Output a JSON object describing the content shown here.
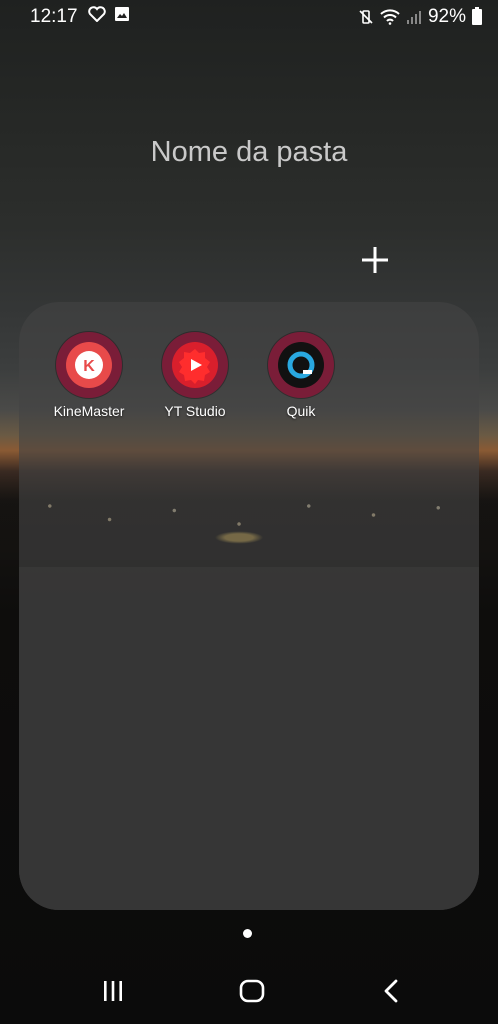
{
  "status_bar": {
    "time": "12:17",
    "battery_percent": "92%",
    "left_icons": [
      "heart-icon",
      "gallery-icon"
    ],
    "right_icons": [
      "vibrate-mute-icon",
      "wifi-icon",
      "signal-icon",
      "battery-icon"
    ]
  },
  "folder": {
    "name_placeholder": "Nome da pasta",
    "add_icon": "plus-icon",
    "apps": [
      {
        "label": "KineMaster",
        "icon": "kinemaster-icon",
        "color": "#e84a4a"
      },
      {
        "label": "YT Studio",
        "icon": "yt-studio-icon",
        "color": "#e62117"
      },
      {
        "label": "Quik",
        "icon": "quik-icon",
        "color": "#111111"
      }
    ]
  },
  "pager": {
    "pages": 1,
    "current": 1
  },
  "nav_bar": {
    "buttons": [
      "recents-icon",
      "home-icon",
      "back-icon"
    ]
  }
}
